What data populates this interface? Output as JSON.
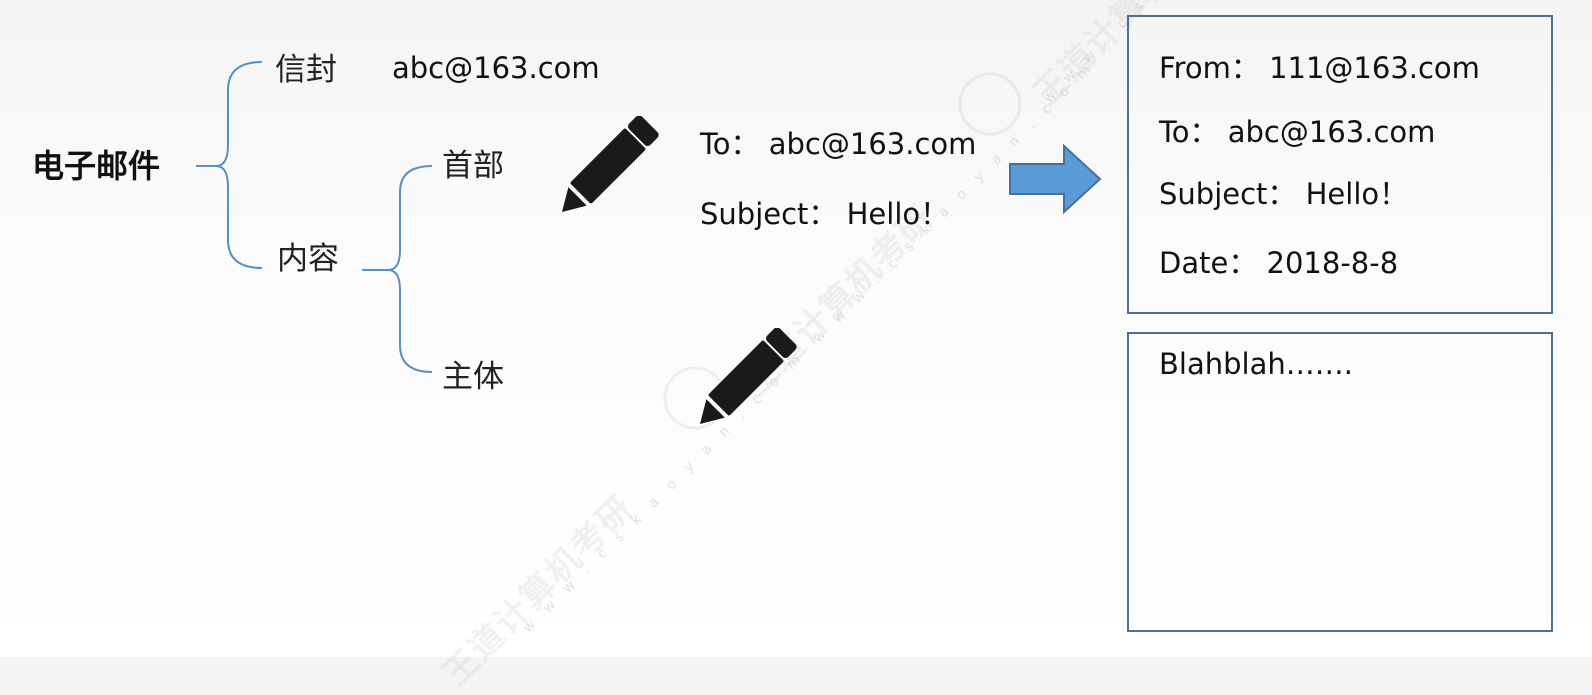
{
  "tree": {
    "root": "电子邮件",
    "envelope": "信封",
    "envelope_value": "abc@163.com",
    "content": "内容",
    "header": "首部",
    "body": "主体"
  },
  "header_fields": {
    "to": "To：  abc@163.com",
    "subject": "Subject：  Hello！"
  },
  "email_header_box": {
    "from": "From：  111@163.com",
    "to": "To：  abc@163.com",
    "subject": "Subject：  Hello！",
    "date": "Date：  2018-8-8"
  },
  "email_body_box": {
    "text": "Blahblah……."
  },
  "watermark": {
    "brand": "王道计算机考研",
    "url": "w w w . c s k a o y a n . c o m"
  },
  "colors": {
    "bracket": "#5b8fc0",
    "box_border": "#4d6f91",
    "arrow": "#5b9bd5",
    "pencil": "#1a1a1a"
  }
}
